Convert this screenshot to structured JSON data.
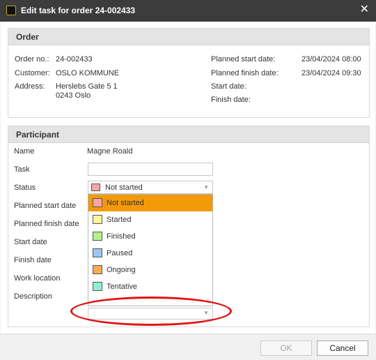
{
  "window": {
    "title": "Edit task for order 24-002433",
    "close_glyph": "✕"
  },
  "order": {
    "header": "Order",
    "left": [
      {
        "label": "Order no.:",
        "value": "24-002433"
      },
      {
        "label": "Customer:",
        "value": "OSLO KOMMUNE"
      },
      {
        "label": "Address:",
        "value": "Herslebs Gate 5 1",
        "value2": "0243 Oslo"
      }
    ],
    "right": [
      {
        "label": "Planned start date:",
        "value": "23/04/2024 08:00"
      },
      {
        "label": "Planned finish date:",
        "value": "23/04/2024 09:30"
      },
      {
        "label": "Start date:",
        "value": ""
      },
      {
        "label": "Finish date:",
        "value": ""
      }
    ]
  },
  "participant": {
    "header": "Participant",
    "name_label": "Name",
    "name_value": "Magne Roald",
    "task_label": "Task",
    "task_value": "",
    "status_label": "Status",
    "status_value": "Not started",
    "status_color": "#f4a6a6",
    "planned_start_label": "Planned start date",
    "planned_finish_label": "Planned finish date",
    "start_label": "Start date",
    "finish_label": "Finish date",
    "work_location_label": "Work location",
    "description_label": "Description"
  },
  "status_options": [
    {
      "label": "Not started",
      "color": "#f4a6a6",
      "selected": true
    },
    {
      "label": "Started",
      "color": "#fff59a",
      "selected": false
    },
    {
      "label": "Finished",
      "color": "#b6f08c",
      "selected": false
    },
    {
      "label": "Paused",
      "color": "#9cc8f0",
      "selected": false
    },
    {
      "label": "Ongoing",
      "color": "#f6ad52",
      "selected": false
    },
    {
      "label": "Tentative",
      "color": "#8ef0d8",
      "selected": false
    }
  ],
  "accent_color": "#f39a0b",
  "footer": {
    "ok_label": "OK",
    "cancel_label": "Cancel"
  }
}
